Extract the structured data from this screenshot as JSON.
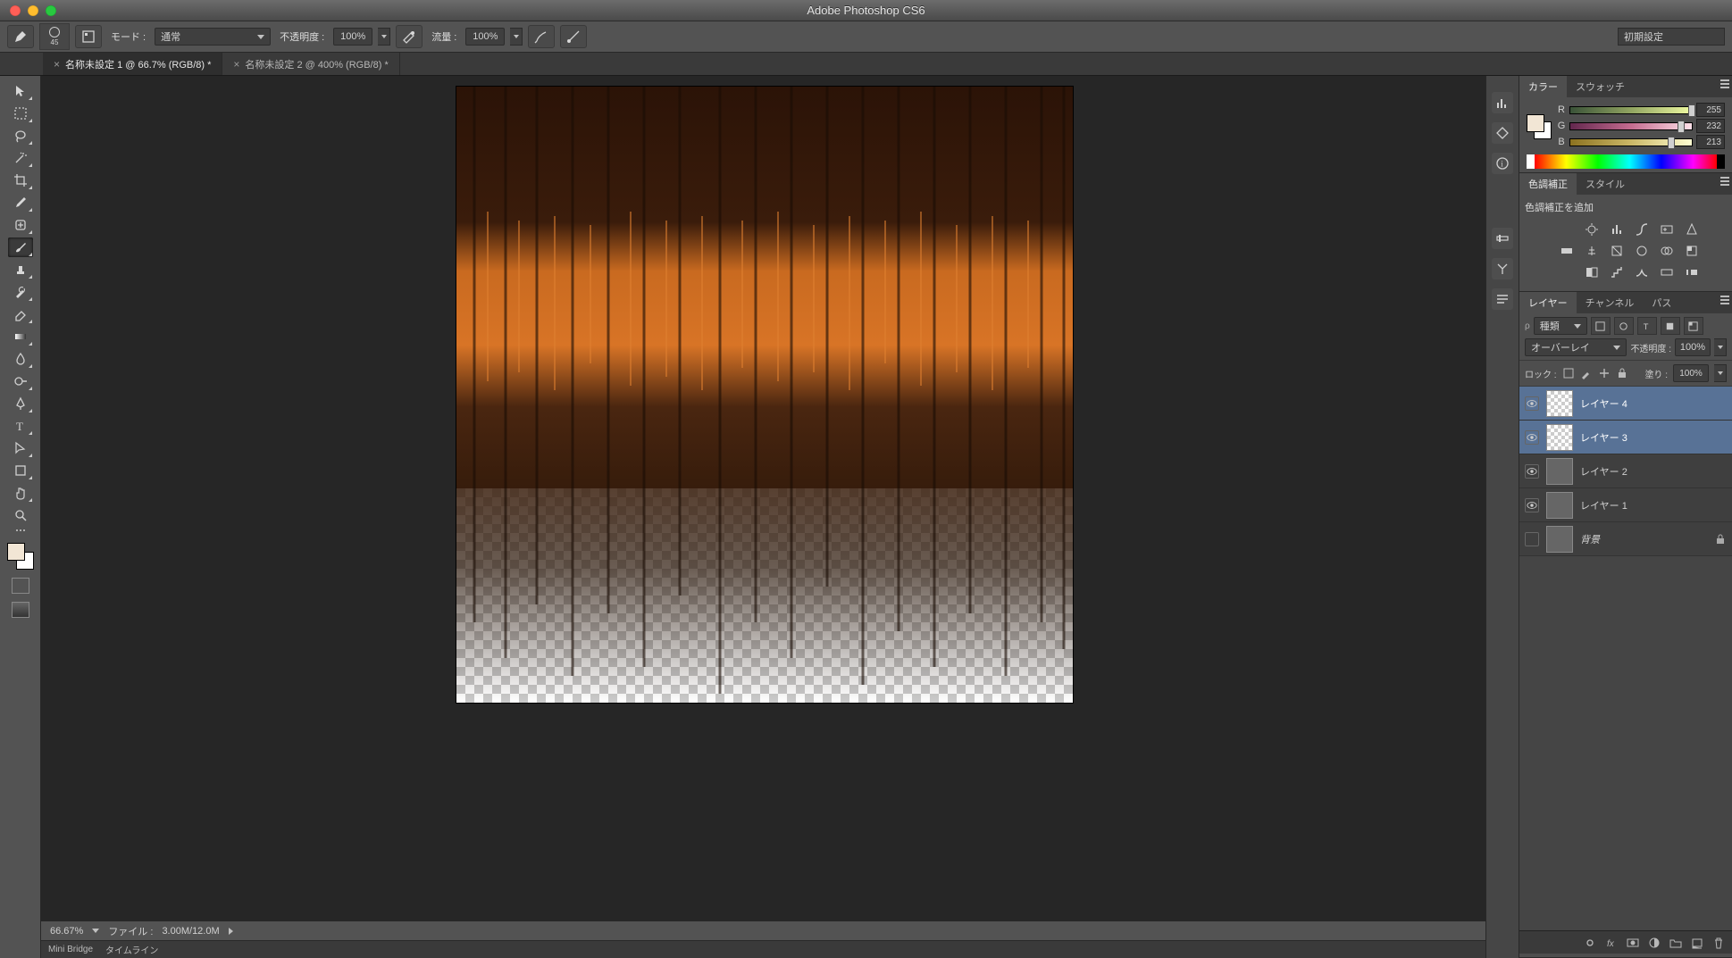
{
  "titlebar": {
    "title": "Adobe Photoshop CS6"
  },
  "optionsbar": {
    "brush_size": "45",
    "mode_label": "モード :",
    "mode_value": "通常",
    "opacity_label": "不透明度 :",
    "opacity_value": "100%",
    "flow_label": "流量 :",
    "flow_value": "100%",
    "workspace": "初期設定"
  },
  "doctabs": [
    {
      "label": "名称未設定 1 @ 66.7% (RGB/8) *",
      "active": true
    },
    {
      "label": "名称未設定 2 @ 400% (RGB/8) *",
      "active": false
    }
  ],
  "status": {
    "zoom": "66.67%",
    "file_label": "ファイル :",
    "file_value": "3.00M/12.0M"
  },
  "bottom_tabs": {
    "a": "Mini Bridge",
    "b": "タイムライン"
  },
  "panels": {
    "color": {
      "tab_color": "カラー",
      "tab_swatch": "スウォッチ",
      "r_label": "R",
      "r_value": "255",
      "g_label": "G",
      "g_value": "232",
      "b_label": "B",
      "b_value": "213"
    },
    "adjust": {
      "tab_adjust": "色調補正",
      "tab_style": "スタイル",
      "header": "色調補正を追加"
    },
    "layers": {
      "tab_layers": "レイヤー",
      "tab_channels": "チャンネル",
      "tab_paths": "パス",
      "filter_label": "種類",
      "blend_value": "オーバーレイ",
      "opacity_label": "不透明度 :",
      "opacity_value": "100%",
      "lock_label": "ロック :",
      "fill_label": "塗り :",
      "fill_value": "100%",
      "items": [
        {
          "name": "レイヤー 4",
          "selected": true,
          "visible": true,
          "locked": false,
          "thumb": "checker"
        },
        {
          "name": "レイヤー 3",
          "selected": true,
          "visible": true,
          "locked": false,
          "thumb": "checker"
        },
        {
          "name": "レイヤー 2",
          "selected": false,
          "visible": true,
          "locked": false,
          "thumb": "brownw"
        },
        {
          "name": "レイヤー 1",
          "selected": false,
          "visible": true,
          "locked": false,
          "thumb": "fire"
        },
        {
          "name": "背景",
          "selected": false,
          "visible": false,
          "locked": true,
          "thumb": "white"
        }
      ]
    }
  }
}
